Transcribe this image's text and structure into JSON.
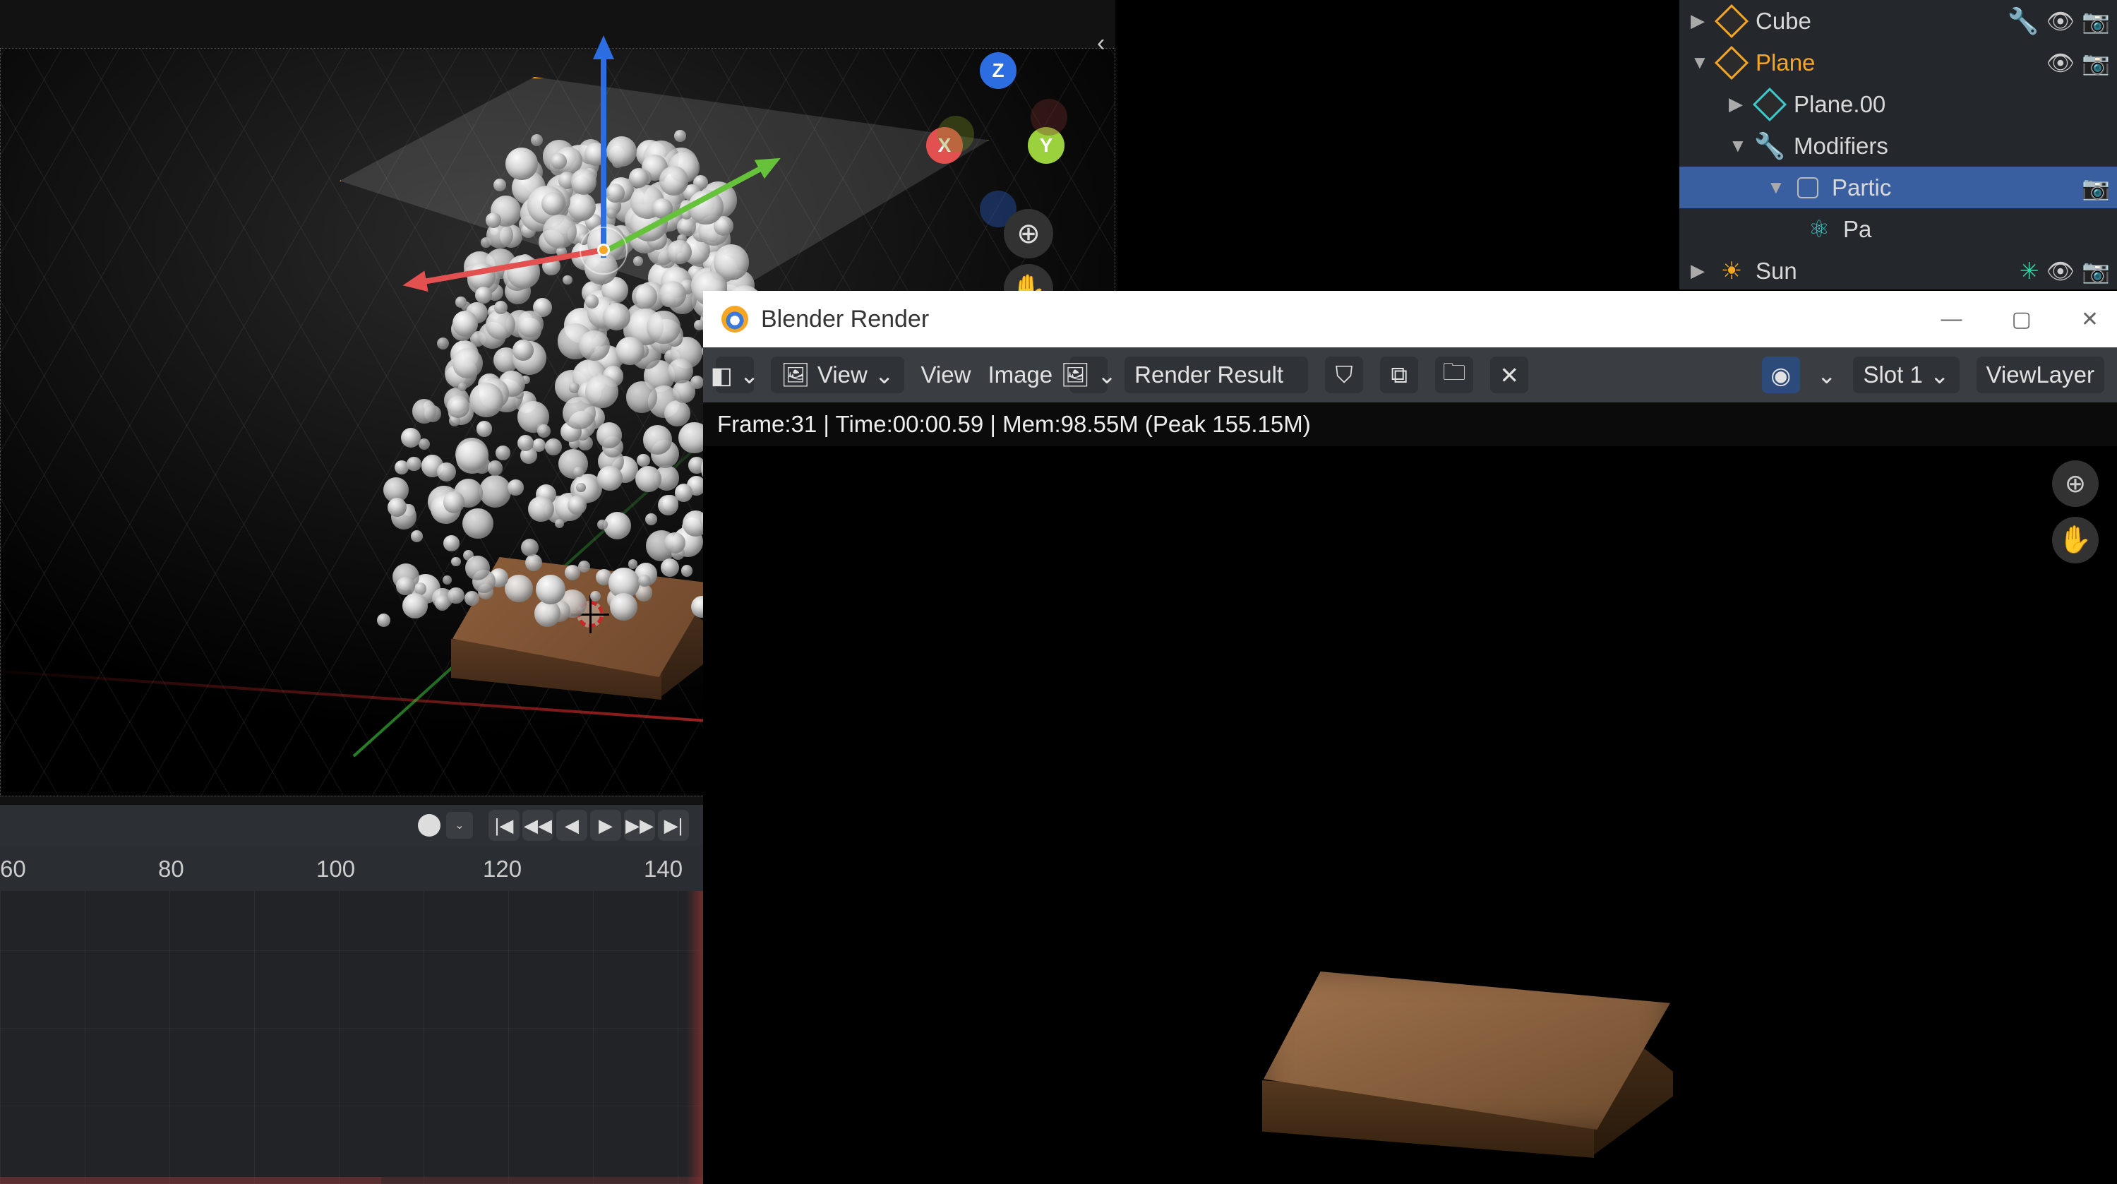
{
  "viewport": {
    "gizmo": {
      "x": "X",
      "y": "Y",
      "z": "Z"
    }
  },
  "outliner": {
    "items": [
      {
        "label": "Cube"
      },
      {
        "label": "Plane"
      },
      {
        "label": "Plane.00"
      },
      {
        "label": "Modifiers"
      },
      {
        "label": "Partic"
      },
      {
        "label": "Pa"
      },
      {
        "label": "Sun"
      }
    ]
  },
  "timeline": {
    "ticks": [
      "60",
      "80",
      "100",
      "120",
      "140"
    ]
  },
  "render_window": {
    "title": "Blender Render",
    "toolbar": {
      "view1": "View",
      "view2": "View",
      "image": "Image",
      "result": "Render Result",
      "slot": "Slot 1",
      "layer": "ViewLayer"
    },
    "status": "Frame:31 | Time:00:00.59 | Mem:98.55M (Peak 155.15M)",
    "window_controls": {
      "min": "—",
      "max": "▢",
      "close": "✕"
    }
  },
  "icons": {
    "zoom": "⊕",
    "hand": "✋",
    "chevron": "‹",
    "split": "›",
    "dropdown": "⌄",
    "shield": "⛉",
    "copy": "⧉",
    "folder": "🗀",
    "x": "✕",
    "globe": "◉",
    "eye": "👁",
    "camera": "📷",
    "wrench": "🔧",
    "sun_small": "☀",
    "light": "✳",
    "play_first": "|◀",
    "play_prevkey": "◀◀",
    "play_prev": "◀",
    "play_next": "▶",
    "play_nextkey": "▶▶",
    "play_last": "▶|"
  }
}
